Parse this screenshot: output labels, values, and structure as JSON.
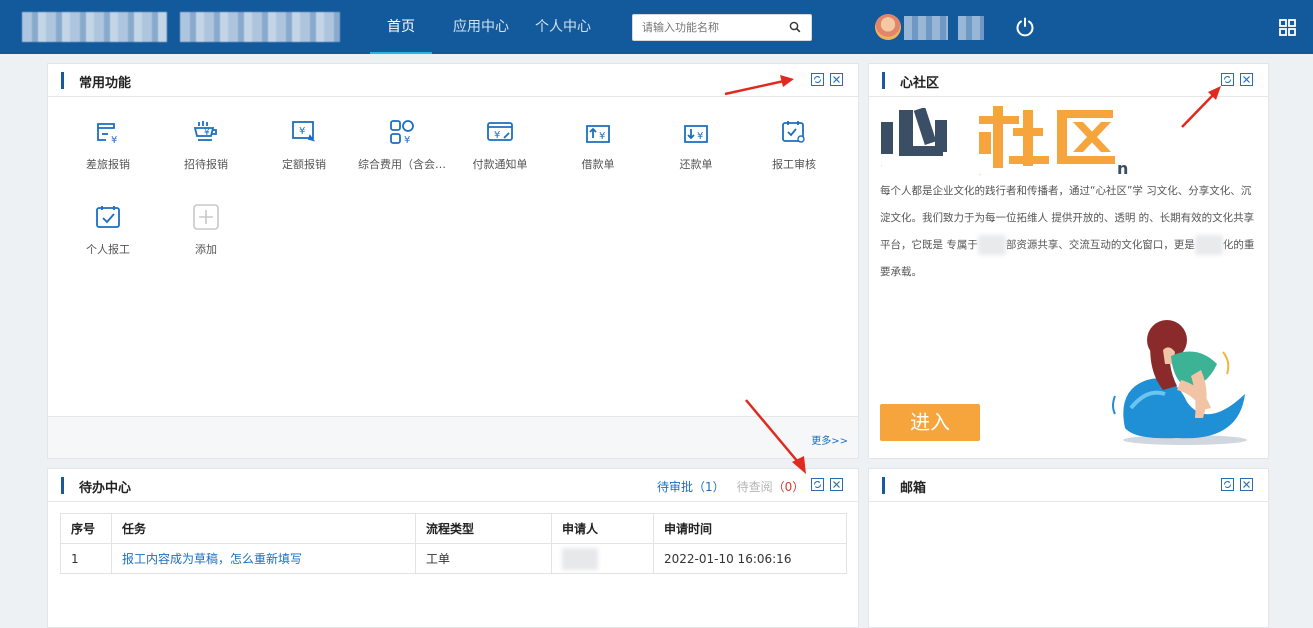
{
  "header": {
    "nav": [
      {
        "label": "首页",
        "active": true
      },
      {
        "label": "应用中心",
        "active": false
      },
      {
        "label": "个人中心",
        "active": false
      }
    ],
    "search_placeholder": "请输入功能名称"
  },
  "common": {
    "title": "常用功能",
    "functions": [
      {
        "label": "差旅报销",
        "icon": "travel-reimburse-icon"
      },
      {
        "label": "招待报销",
        "icon": "hospitality-reimburse-icon"
      },
      {
        "label": "定额报销",
        "icon": "fixed-reimburse-icon"
      },
      {
        "label": "综合费用（含会…",
        "icon": "general-expense-icon"
      },
      {
        "label": "付款通知单",
        "icon": "payment-notice-icon"
      },
      {
        "label": "借款单",
        "icon": "loan-form-icon"
      },
      {
        "label": "还款单",
        "icon": "repayment-form-icon"
      },
      {
        "label": "报工审核",
        "icon": "work-report-review-icon"
      },
      {
        "label": "个人报工",
        "icon": "personal-work-report-icon"
      },
      {
        "label": "添加",
        "icon": "add-icon"
      }
    ],
    "more": "更多>>"
  },
  "community": {
    "title": "心社区",
    "logo_left": "心",
    "logo_right": "社区",
    "text_1": "每个人都是企业文化的践行者和传播者，通过“心社区”学 习文化、分享文化、沉淀文化。我们致力于为每一位拓维人 提供开放的、透明 的、长期有效的文化共享平台，它既是 专属于",
    "text_2": "部资源共享、交流互动的文化窗口，更是",
    "text_3": "化的重要承载。",
    "enter": "进入"
  },
  "todo": {
    "title": "待办中心",
    "tab_pending": "待审批",
    "pending_count": "（1）",
    "tab_read": "待查阅",
    "read_count": "（0）",
    "columns": [
      "序号",
      "任务",
      "流程类型",
      "申请人",
      "申请时间"
    ],
    "rows": [
      {
        "no": "1",
        "task": "报工内容成为草稿，怎么重新填写",
        "type": "工单",
        "time": "2022-01-10 16:06:16"
      }
    ]
  },
  "mail": {
    "title": "邮箱"
  },
  "colors": {
    "header": "#135a9c",
    "accent": "#1b6fc0",
    "enter_button": "#f6a43c",
    "annotation_arrow": "#e02a1f"
  }
}
